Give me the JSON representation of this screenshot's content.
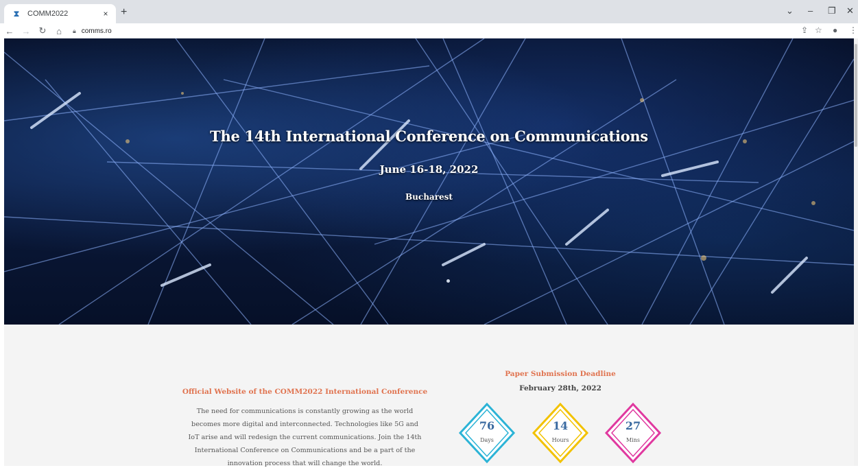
{
  "browser": {
    "tab_title": "COMM2022",
    "tab_close": "×",
    "new_tab": "+",
    "url": "comms.ro",
    "favicon": "hourglass-icon"
  },
  "hero": {
    "title": "The 14th International Conference on Communications",
    "date": "June 16-18, 2022",
    "city": "Bucharest"
  },
  "intro": {
    "heading": "Official Website of the COMM2022 International Conference",
    "lines": [
      "The need for communications is constantly growing as the world",
      "becomes more digital and interconnected. Technologies like 5G and",
      "IoT arise and will redesign the current communications. Join the 14th",
      "International Conference on Communications and be a part of the",
      "innovation process that will change the world."
    ]
  },
  "deadline": {
    "label": "Paper Submission Deadline",
    "date": "February 28th, 2022"
  },
  "countdown": [
    {
      "value": "76",
      "unit": "Days",
      "color": "#2bb3d6"
    },
    {
      "value": "14",
      "unit": "Hours",
      "color": "#f2c200"
    },
    {
      "value": "27",
      "unit": "Mins",
      "color": "#e0389f"
    }
  ],
  "colors": {
    "accent": "#e0734f",
    "count_number": "#3a6aa0"
  }
}
